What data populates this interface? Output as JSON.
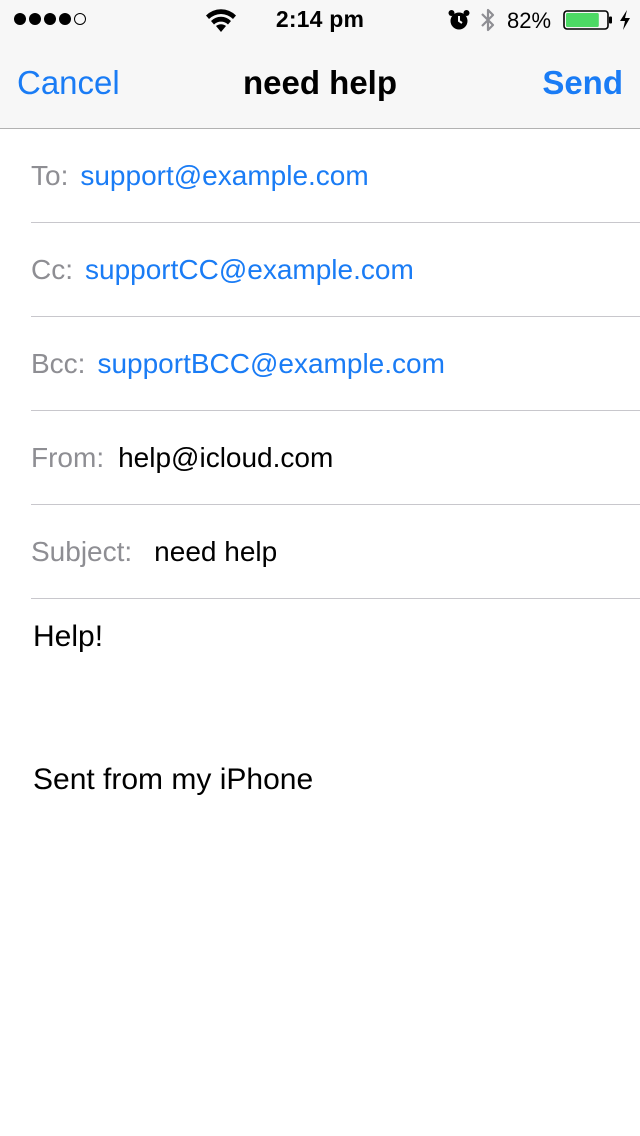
{
  "status_bar": {
    "time": "2:14 pm",
    "battery_percent": "82%",
    "battery_level": 0.82,
    "signal_bars_filled": 4,
    "signal_bars_total": 5,
    "icons": [
      "signal-dots",
      "wifi-icon",
      "alarm-icon",
      "bluetooth-icon",
      "battery-icon",
      "charging-bolt-icon"
    ]
  },
  "nav": {
    "cancel_label": "Cancel",
    "title": "need help",
    "send_label": "Send"
  },
  "fields": {
    "to": {
      "label": "To:",
      "value": "support@example.com"
    },
    "cc": {
      "label": "Cc:",
      "value": "supportCC@example.com"
    },
    "bcc": {
      "label": "Bcc:",
      "value": "supportBCC@example.com"
    },
    "from": {
      "label": "From:",
      "value": "help@icloud.com"
    },
    "subject": {
      "label": "Subject:",
      "value": "need help"
    }
  },
  "body": {
    "message": "Help!",
    "signature": "Sent from my iPhone"
  },
  "colors": {
    "accent": "#1a7cf5",
    "label_gray": "#8e8e93",
    "battery_green": "#4cd964"
  }
}
